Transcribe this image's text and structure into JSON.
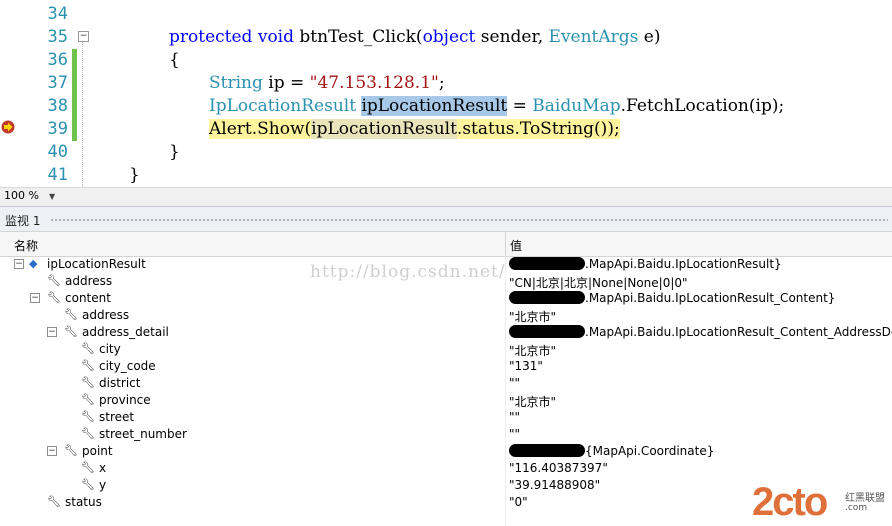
{
  "editor": {
    "line_numbers": [
      "34",
      "35",
      "36",
      "37",
      "38",
      "39",
      "40",
      "41"
    ],
    "lines": {
      "l35": {
        "kw1": "protected",
        "kw2": "void",
        "method": "btnTest_Click(",
        "kw3": "object",
        "param1": " sender, ",
        "type1": "EventArgs",
        "param2": " e)"
      },
      "l36": "{",
      "l37": {
        "type": "String",
        "rest": " ip = ",
        "str": "\"47.153.128.1\"",
        "end": ";"
      },
      "l38": {
        "type": "IpLocationResult",
        "sp": " ",
        "var": "ipLocationResult",
        "mid": " = ",
        "type2": "BaiduMap",
        "rest": ".FetchLocation(ip);"
      },
      "l39": {
        "a": "Alert.Show(",
        "b": "ipLocationResult",
        "c": ".status.ToString());"
      },
      "l40": "}",
      "l41": "}"
    }
  },
  "zoom": {
    "value": "100 %"
  },
  "watch": {
    "title": "监视 1",
    "columns": {
      "name": "名称",
      "value": "值"
    },
    "rows": [
      {
        "name": "ipLocationResult",
        "value": ".MapApi.Baidu.IpLocationResult}",
        "redacted": true
      },
      {
        "name": "address",
        "value": "\"CN|北京|北京|None|None|0|0\""
      },
      {
        "name": "content",
        "value": ".MapApi.Baidu.IpLocationResult_Content}",
        "redacted": true
      },
      {
        "name": "address",
        "value": "\"北京市\""
      },
      {
        "name": "address_detail",
        "value": ".MapApi.Baidu.IpLocationResult_Content_AddressDetail}",
        "redacted": true
      },
      {
        "name": "city",
        "value": "\"北京市\""
      },
      {
        "name": "city_code",
        "value": "\"131\""
      },
      {
        "name": "district",
        "value": "\"\""
      },
      {
        "name": "province",
        "value": "\"北京市\""
      },
      {
        "name": "street",
        "value": "\"\""
      },
      {
        "name": "street_number",
        "value": "\"\""
      },
      {
        "name": "point",
        "value": "{MapApi.Coordinate}",
        "redacted": true
      },
      {
        "name": "x",
        "value": "\"116.40387397\""
      },
      {
        "name": "y",
        "value": "\"39.91488908\""
      },
      {
        "name": "status",
        "value": "\"0\""
      }
    ]
  },
  "watermark": "http://blog.csdn.net/",
  "logo": {
    "text": "2cto",
    "sub": "红黑联盟",
    "url": ".com"
  }
}
